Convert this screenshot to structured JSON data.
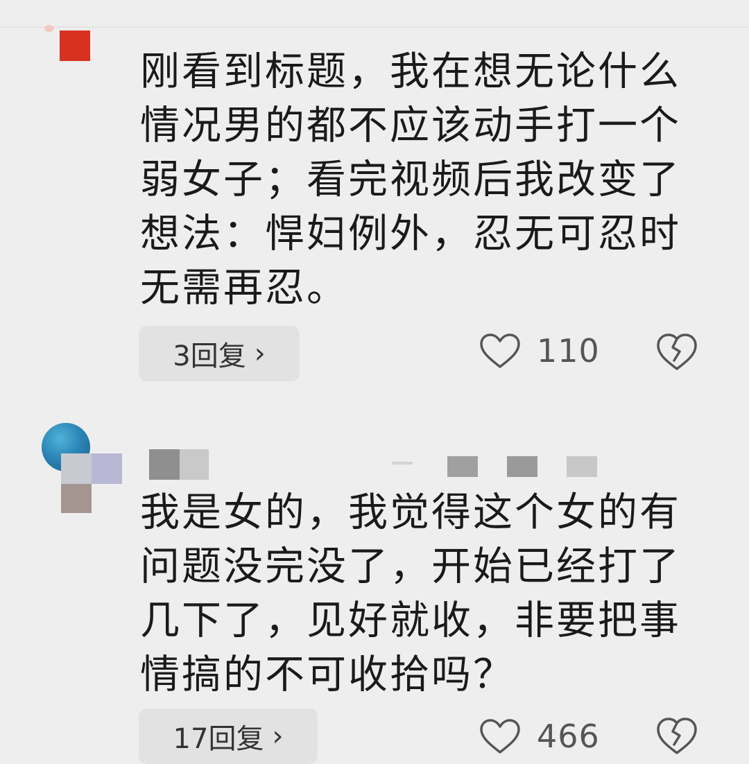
{
  "comments": [
    {
      "text": "刚看到标题，我在想无论什么\n情况男的都不应该动手打一个\n弱女子；看完视频后我改变了\n想法：悍妇例外，忍无可忍时\n无需再忍。",
      "replies_label": "3回复",
      "likes": "110",
      "avatar_color": "#d7321f"
    },
    {
      "text": "我是女的，我觉得这个女的有\n问题没完没了，开始已经打了\n几下了，见好就收，非要把事\n情搞的不可收拾吗？",
      "replies_label": "17回复",
      "likes": "466",
      "avatar_color": "#2b86b7"
    }
  ],
  "icons": {
    "like": "heart-outline-icon",
    "dislike": "broken-heart-icon",
    "replies_arrow": "chevron-right-icon"
  },
  "colors": {
    "background": "#eeeeee",
    "button_bg": "#e2e2e2",
    "icon_stroke": "#555555"
  }
}
